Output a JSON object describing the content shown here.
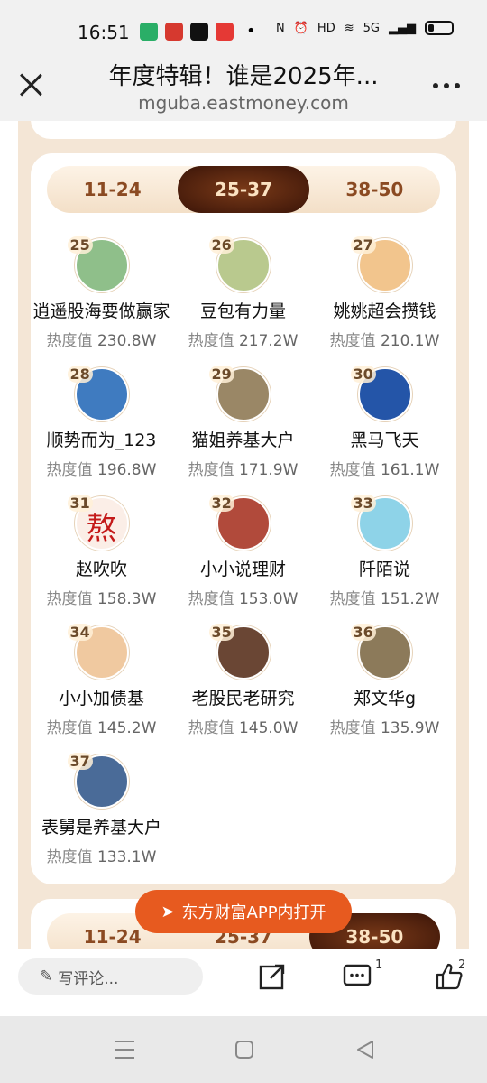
{
  "status_bar": {
    "time": "16:51",
    "network": "5G",
    "app_icons": [
      {
        "name": "wechat-icon",
        "color": "#2aae67"
      },
      {
        "name": "cctv-icon",
        "color": "#d6392f"
      },
      {
        "name": "tiktok-icon",
        "color": "#111111"
      },
      {
        "name": "toutiao-icon",
        "color": "#e53935"
      }
    ]
  },
  "header": {
    "title": "年度特辑！谁是2025年...",
    "url": "mguba.eastmoney.com"
  },
  "tabs": [
    {
      "label": "11-24",
      "active": false
    },
    {
      "label": "25-37",
      "active": true
    },
    {
      "label": "38-50",
      "active": false
    }
  ],
  "heat_label": "热度值",
  "users": [
    {
      "rank": "25",
      "name": "逍遥股海要做赢家",
      "heat": "230.8W",
      "avatar_color": "#8fbf8a"
    },
    {
      "rank": "26",
      "name": "豆包有力量",
      "heat": "217.2W",
      "avatar_color": "#b9c98e"
    },
    {
      "rank": "27",
      "name": "姚姚超会攒钱",
      "heat": "210.1W",
      "avatar_color": "#f2c58d"
    },
    {
      "rank": "28",
      "name": "顺势而为_123",
      "heat": "196.8W",
      "avatar_color": "#3f7bc0"
    },
    {
      "rank": "29",
      "name": "猫姐养基大户",
      "heat": "171.9W",
      "avatar_color": "#9a8766"
    },
    {
      "rank": "30",
      "name": "黑马飞天",
      "heat": "161.1W",
      "avatar_color": "#2455a8"
    },
    {
      "rank": "31",
      "name": "赵吹吹",
      "heat": "158.3W",
      "avatar_color": "#fbeee7",
      "glyph": "熬"
    },
    {
      "rank": "32",
      "name": "小小说理财",
      "heat": "153.0W",
      "avatar_color": "#b14a3b"
    },
    {
      "rank": "33",
      "name": "阡陌说",
      "heat": "151.2W",
      "avatar_color": "#8ed3e8"
    },
    {
      "rank": "34",
      "name": "小小加债基",
      "heat": "145.2W",
      "avatar_color": "#f0c9a0"
    },
    {
      "rank": "35",
      "name": "老股民老研究",
      "heat": "145.0W",
      "avatar_color": "#6a4634"
    },
    {
      "rank": "36",
      "name": "郑文华g",
      "heat": "135.9W",
      "avatar_color": "#8c7a5a"
    },
    {
      "rank": "37",
      "name": "表舅是养基大户",
      "heat": "133.1W",
      "avatar_color": "#4a6b98"
    }
  ],
  "open_app_label": "东方财富APP内打开",
  "next_tabs": [
    "11-24",
    "25-37",
    "38-50"
  ],
  "bottom_bar": {
    "comment_placeholder": "写评论...",
    "comment_count": "1",
    "like_count": "2"
  }
}
